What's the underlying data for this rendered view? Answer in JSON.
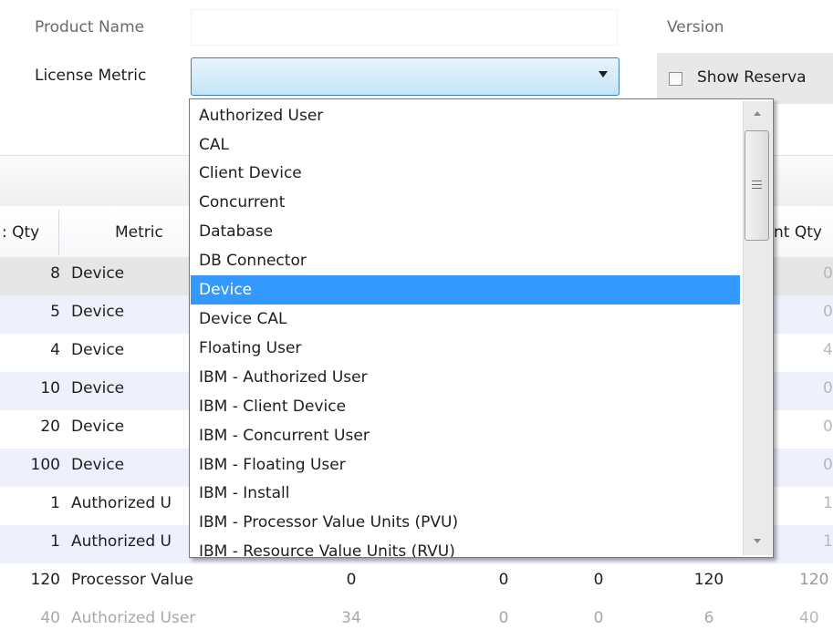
{
  "form": {
    "product_name_label": "Product Name",
    "product_name_value": "",
    "version_label": "Version",
    "license_metric_label": "License Metric",
    "license_metric_value": "",
    "show_reservations_label": "Show Reserva"
  },
  "grid": {
    "headers": {
      "qty": ": Qty",
      "metric": "Metric",
      "right_qty": "nt Qty"
    },
    "rows": [
      {
        "qty": "8",
        "metric": "Device",
        "right": "0"
      },
      {
        "qty": "5",
        "metric": "Device",
        "right": "0"
      },
      {
        "qty": "4",
        "metric": "Device",
        "right": "4"
      },
      {
        "qty": "10",
        "metric": "Device",
        "right": "0"
      },
      {
        "qty": "20",
        "metric": "Device",
        "right": "0"
      },
      {
        "qty": "100",
        "metric": "Device",
        "right": "0"
      },
      {
        "qty": "1",
        "metric": "Authorized U",
        "right": "1"
      },
      {
        "qty": "1",
        "metric": "Authorized U",
        "right": "1"
      },
      {
        "qty": "120",
        "metric": "Processor Value",
        "c1": "0",
        "c2": "0",
        "c3": "0",
        "c4": "120",
        "right": "120"
      },
      {
        "qty": "40",
        "metric": "Authorized User",
        "c1": "34",
        "c2": "0",
        "c3": "0",
        "c4": "6",
        "right": "40"
      }
    ]
  },
  "dropdown": {
    "selected": "Device",
    "options": [
      "Authorized User",
      "CAL",
      "Client Device",
      "Concurrent",
      "Database",
      "DB Connector",
      "Device",
      "Device CAL",
      "Floating User",
      "IBM - Authorized User",
      "IBM - Client Device",
      "IBM - Concurrent User",
      "IBM - Floating User",
      "IBM - Install",
      "IBM - Processor Value Units (PVU)",
      "IBM - Resource Value Units (RVU)"
    ]
  },
  "colors": {
    "selection": "#3399ff",
    "combo_border": "#3c7fb1",
    "alt_row": "#eef1fb"
  }
}
